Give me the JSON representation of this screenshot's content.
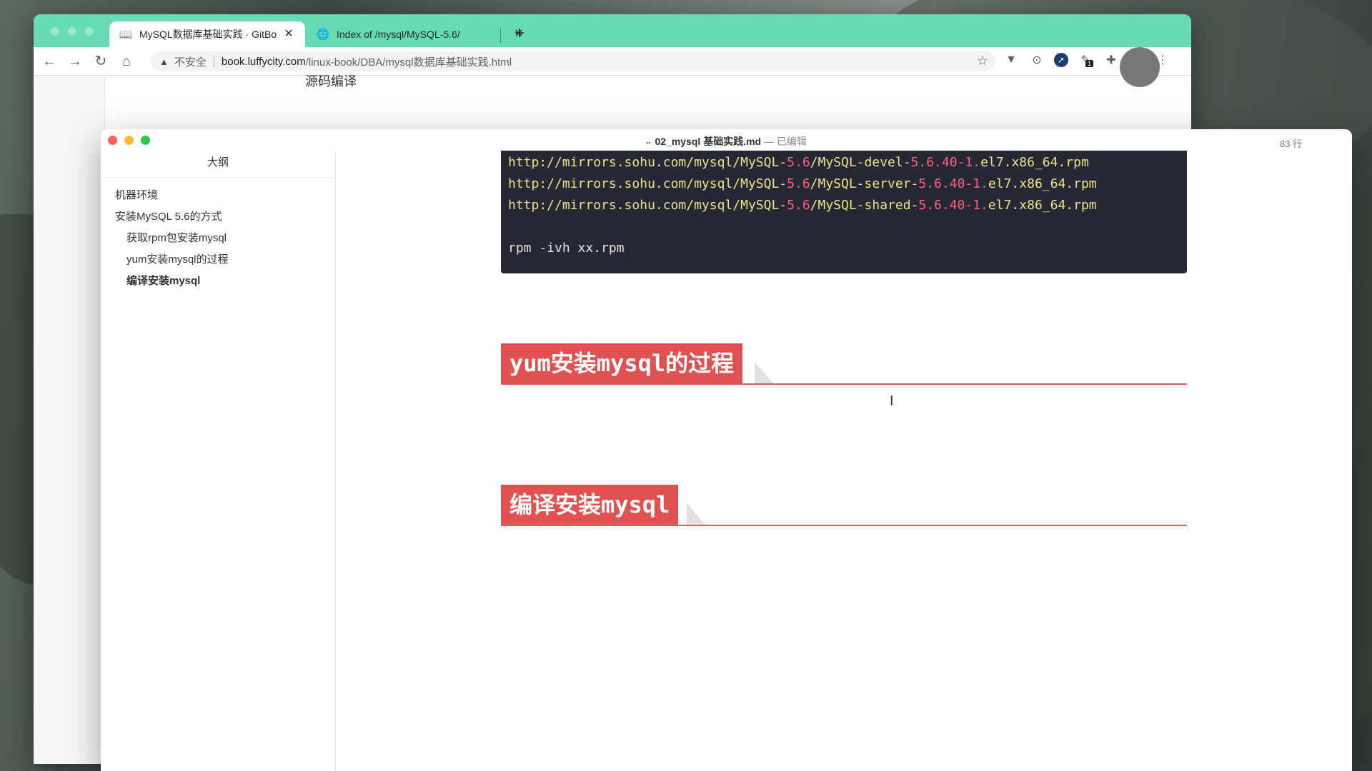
{
  "browser": {
    "tabs": [
      {
        "title": "MySQL数据库基础实践 · GitBo",
        "icon": "book-icon",
        "active": true
      },
      {
        "title": "Index of /mysql/MySQL-5.6/",
        "icon": "globe-icon",
        "active": false
      }
    ],
    "new_tab_symbol": "+",
    "close_symbol": "✕",
    "address": {
      "warning_symbol": "▲",
      "insecure_label": "不安全",
      "host": "book.luffycity.com",
      "path": "/linux-book/DBA/mysql数据库基础实践.html"
    },
    "nav": {
      "back": "←",
      "forward": "→",
      "reload": "↻",
      "home": "⌂"
    },
    "extension_badge": "1",
    "page_partial_heading": "源码编译"
  },
  "editor": {
    "document_name": "02_mysql 基础实践.md",
    "status": "— 已编辑",
    "line_count": "83 行",
    "outline": {
      "header": "大纲",
      "items": [
        {
          "label": "机器环境",
          "level": 2,
          "active": false
        },
        {
          "label": "安装MySQL 5.6的方式",
          "level": 2,
          "active": false
        },
        {
          "label": "获取rpm包安装mysql",
          "level": 3,
          "active": false
        },
        {
          "label": "yum安装mysql的过程",
          "level": 3,
          "active": false
        },
        {
          "label": "编译安装mysql",
          "level": 3,
          "active": true
        }
      ]
    },
    "code_lines": [
      {
        "pre": "http://mirrors.sohu.com/mysql/MySQL-",
        "ver": "5.6",
        "mid": "/MySQL-devel-",
        "ver2": "5.6.40-1.",
        "post": "el7.x86_64.rpm"
      },
      {
        "pre": "http://mirrors.sohu.com/mysql/MySQL-",
        "ver": "5.6",
        "mid": "/MySQL-server-",
        "ver2": "5.6.40-1.",
        "post": "el7.x86_64.rpm"
      },
      {
        "pre": "http://mirrors.sohu.com/mysql/MySQL-",
        "ver": "5.6",
        "mid": "/MySQL-shared-",
        "ver2": "5.6.40-1.",
        "post": "el7.x86_64.rpm"
      }
    ],
    "code_command": "rpm -ivh xx.rpm",
    "headings": [
      {
        "text": "yum安装mysql的过程"
      },
      {
        "text": "编译安装mysql"
      }
    ]
  },
  "colors": {
    "tabstrip": "#67dbb5",
    "heading_bg": "#e05252",
    "code_bg": "#272836"
  }
}
